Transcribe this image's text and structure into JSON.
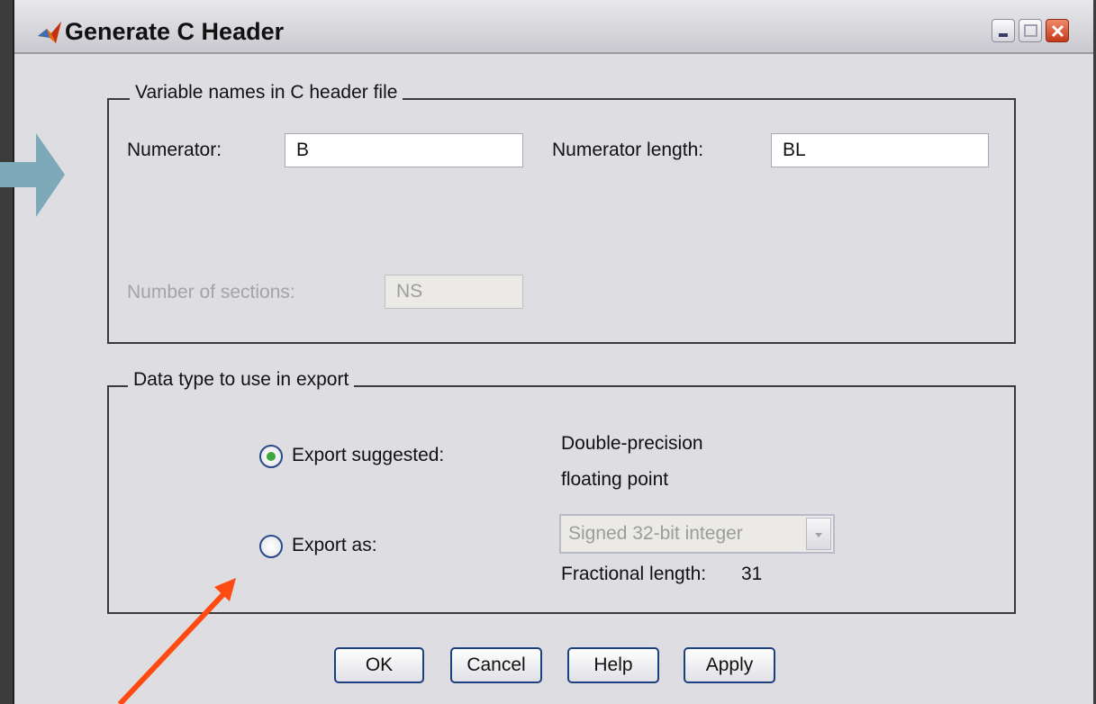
{
  "window": {
    "title": "Generate C Header",
    "controls": {
      "minimize_icon": "minimize-icon",
      "maximize_icon": "maximize-icon",
      "close_icon": "close-icon"
    }
  },
  "variable_names_group": {
    "legend": "Variable names in C header file",
    "numerator_label": "Numerator:",
    "numerator_value": "B",
    "numerator_length_label": "Numerator length:",
    "numerator_length_value": "BL",
    "num_sections_label": "Number of sections:",
    "num_sections_value": "NS"
  },
  "data_type_group": {
    "legend": "Data type to use in export",
    "export_suggested_label": "Export suggested:",
    "export_suggested_selected": true,
    "suggested_type_line1": "Double-precision",
    "suggested_type_line2": "floating point",
    "export_as_label": "Export as:",
    "export_as_selected": false,
    "export_as_type": "Signed 32-bit integer",
    "fractional_length_label": "Fractional length:",
    "fractional_length_value": "31"
  },
  "buttons": {
    "ok": "OK",
    "cancel": "Cancel",
    "help": "Help",
    "apply": "Apply"
  },
  "colors": {
    "annotation_block_arrow": "#7da9b8",
    "annotation_pointer_arrow": "#ff4a12",
    "radio_selected": "#3ea83e"
  }
}
